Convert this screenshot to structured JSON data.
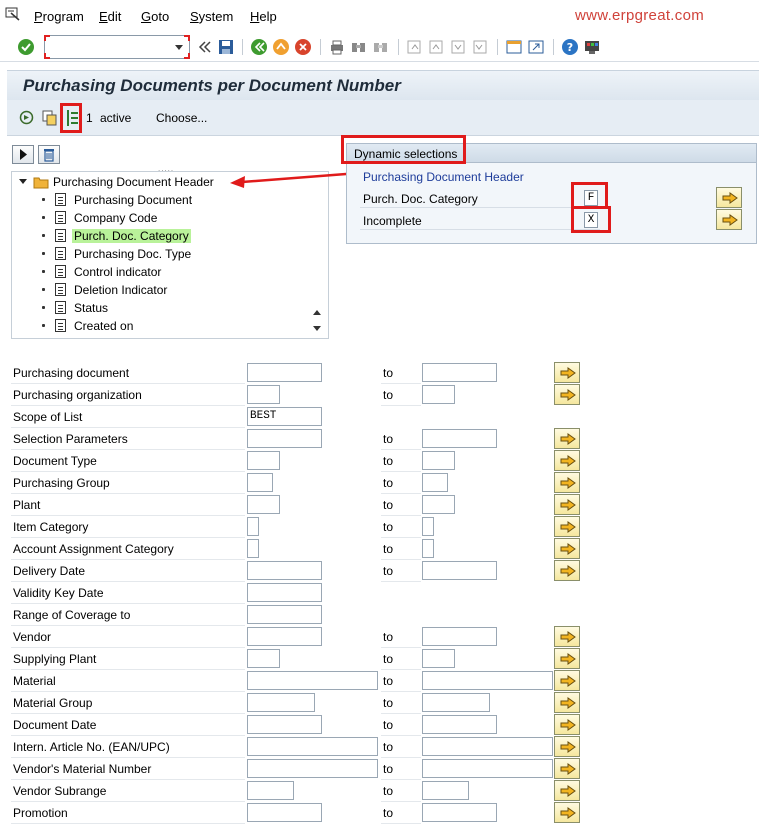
{
  "menubar": {
    "items": [
      {
        "label": "Program",
        "hotkey": "P"
      },
      {
        "label": "Edit",
        "hotkey": "E"
      },
      {
        "label": "Goto",
        "hotkey": "G"
      },
      {
        "label": "System",
        "hotkey": "S"
      },
      {
        "label": "Help",
        "hotkey": "H"
      }
    ],
    "watermark": "www.erpgreat.com"
  },
  "toolbar": {
    "command_field_value": ""
  },
  "title": "Purchasing Documents per Document Number",
  "app_toolbar": {
    "active_count": "1",
    "active_label": "active",
    "choose_label": "Choose..."
  },
  "tree": {
    "root": "Purchasing Document Header",
    "items": [
      {
        "label": "Purchasing Document",
        "highlighted": false
      },
      {
        "label": "Company Code",
        "highlighted": false
      },
      {
        "label": "Purch. Doc. Category",
        "highlighted": true
      },
      {
        "label": "Purchasing Doc. Type",
        "highlighted": false
      },
      {
        "label": "Control indicator",
        "highlighted": false
      },
      {
        "label": "Deletion Indicator",
        "highlighted": false
      },
      {
        "label": "Status",
        "highlighted": false
      },
      {
        "label": "Created on",
        "highlighted": false
      }
    ]
  },
  "dynamic": {
    "header": "Dynamic selections",
    "group": "Purchasing Document Header",
    "fields": [
      {
        "label": "Purch. Doc. Category",
        "value": "F"
      },
      {
        "label": "Incomplete",
        "value": "X"
      }
    ]
  },
  "selection": {
    "to_label": "to",
    "rows": [
      {
        "label": "Purchasing document",
        "value": "",
        "has_to": true,
        "has_more": true
      },
      {
        "label": "Purchasing organization",
        "value": "",
        "has_to": true,
        "has_more": true
      },
      {
        "label": "Scope of List",
        "value": "BEST",
        "has_to": false,
        "has_more": false
      },
      {
        "label": "Selection Parameters",
        "value": "",
        "has_to": true,
        "has_more": true
      },
      {
        "label": "Document Type",
        "value": "",
        "has_to": true,
        "has_more": true
      },
      {
        "label": "Purchasing Group",
        "value": "",
        "has_to": true,
        "has_more": true
      },
      {
        "label": "Plant",
        "value": "",
        "has_to": true,
        "has_more": true
      },
      {
        "label": "Item Category",
        "value": "",
        "has_to": true,
        "has_more": true
      },
      {
        "label": "Account Assignment Category",
        "value": "",
        "has_to": true,
        "has_more": true
      },
      {
        "label": "Delivery Date",
        "value": "",
        "has_to": true,
        "has_more": true
      },
      {
        "label": "Validity Key Date",
        "value": "",
        "has_to": false,
        "has_more": false
      },
      {
        "label": "Range of Coverage to",
        "value": "",
        "has_to": false,
        "has_more": false
      },
      {
        "label": "Vendor",
        "value": "",
        "has_to": true,
        "has_more": true
      },
      {
        "label": "Supplying Plant",
        "value": "",
        "has_to": true,
        "has_more": true
      },
      {
        "label": "Material",
        "value": "",
        "has_to": true,
        "has_more": true
      },
      {
        "label": "Material Group",
        "value": "",
        "has_to": true,
        "has_more": true
      },
      {
        "label": "Document Date",
        "value": "",
        "has_to": true,
        "has_more": true
      },
      {
        "label": "Intern. Article No. (EAN/UPC)",
        "value": "",
        "has_to": true,
        "has_more": true
      },
      {
        "label": "Vendor's Material Number",
        "value": "",
        "has_to": true,
        "has_more": true
      },
      {
        "label": "Vendor Subrange",
        "value": "",
        "has_to": true,
        "has_more": true
      },
      {
        "label": "Promotion",
        "value": "",
        "has_to": true,
        "has_more": true
      }
    ]
  },
  "colors": {
    "annotation_red": "#e01b1b",
    "highlight_green": "#b9f29a",
    "link_blue": "#1d3c9a",
    "watermark": "#d0423a"
  }
}
